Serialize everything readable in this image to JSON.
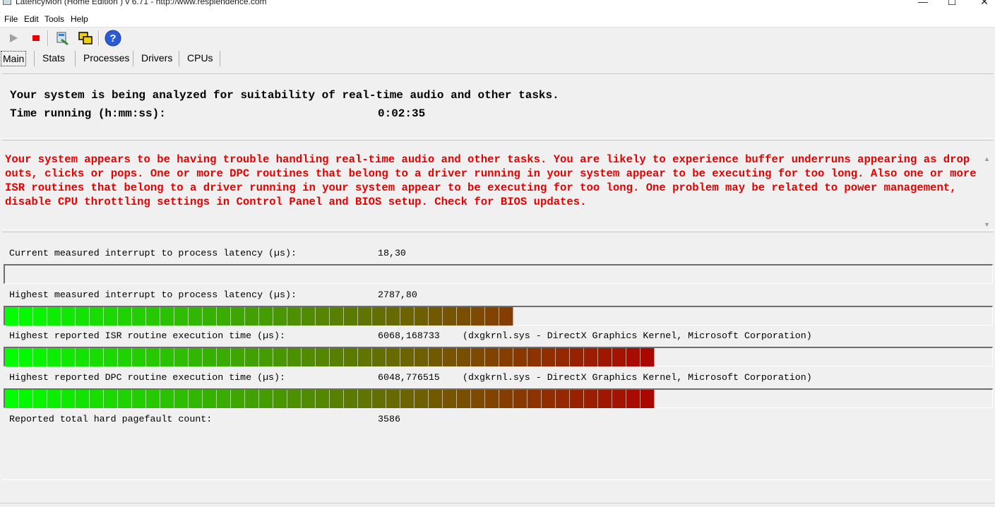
{
  "window": {
    "title": "LatencyMon  (Home Edition )  v 6.71 - http://www.resplendence.com",
    "controls": {
      "minimize": "—",
      "maximize": "☐",
      "close": "✕"
    }
  },
  "menu": [
    "File",
    "Edit",
    "Tools",
    "Help"
  ],
  "toolbar": {
    "buttons": [
      {
        "name": "start",
        "icon": "play-icon",
        "enabled": false
      },
      {
        "name": "stop",
        "icon": "stop-icon",
        "color": "#e60000"
      },
      {
        "name": "tools",
        "icon": "tools-icon"
      },
      {
        "name": "windows",
        "icon": "windows-icon"
      },
      {
        "name": "help",
        "icon": "help-icon",
        "color": "#2a5bd7"
      }
    ]
  },
  "tabs": [
    "Main",
    "Stats",
    "Processes",
    "Drivers",
    "CPUs"
  ],
  "status": {
    "analyzing": "Your system is being analyzed for suitability of real-time audio and other tasks.",
    "time_label": "Time running (h:mm:ss):",
    "time_value": "0:02:35"
  },
  "warning": {
    "text": "Your system appears to be having trouble handling real-time audio and other tasks. You are likely to experience buffer underruns appearing as drop outs, clicks or pops. One or more DPC routines that belong to a driver running in your system appear to be executing for too long. Also one or more ISR routines that belong to a driver running in your system appear to be executing for too long. One problem may be related to power management, disable CPU throttling settings in Control Panel and BIOS setup. Check for BIOS updates.",
    "color": "#e60000"
  },
  "metrics": [
    {
      "label": "Current measured interrupt to process latency (µs):",
      "value": "18,30",
      "detail": "",
      "meter_fill": 0.0
    },
    {
      "label": "Highest measured interrupt to process latency (µs):",
      "value": "2787,80",
      "detail": "",
      "meter_fill": 0.508
    },
    {
      "label": "Highest reported ISR routine execution time (µs):",
      "value": "6068,168733",
      "detail": "(dxgkrnl.sys - DirectX Graphics Kernel, Microsoft Corporation)",
      "meter_fill": 0.658
    },
    {
      "label": "Highest reported DPC routine execution time (µs):",
      "value": "6048,776515",
      "detail": "(dxgkrnl.sys - DirectX Graphics Kernel, Microsoft Corporation)",
      "meter_fill": 0.658
    },
    {
      "label": "Reported total hard pagefault count:",
      "value": "3586",
      "detail": ""
    }
  ],
  "colors": {
    "meter_start": "#00ff00",
    "meter_end": "#b00000"
  }
}
